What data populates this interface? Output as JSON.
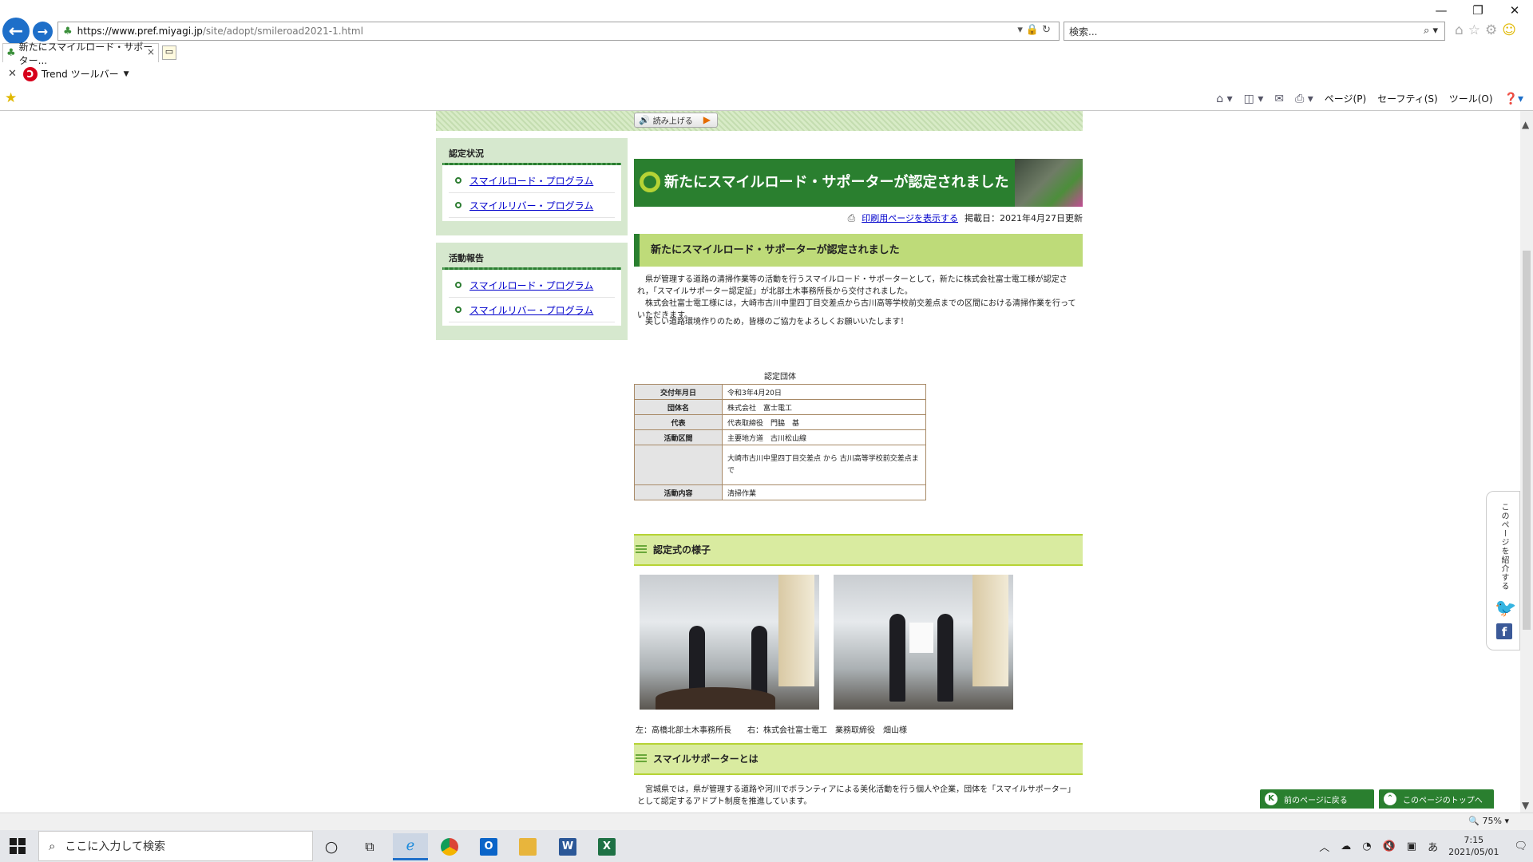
{
  "browser": {
    "url_scheme": "https://www.pref.miyagi.jp",
    "url_rest": "/site/adopt/smileroad2021-1.html",
    "search_placeholder": "検索...",
    "tab_title": "新たにスマイルロード・サポーター...",
    "trend_toolbar_label": "Trend ツールバー",
    "cmd_page": "ページ(P)",
    "cmd_safety": "セーフティ(S)",
    "cmd_tools": "ツール(O)",
    "zoom": "75%"
  },
  "sidebar": {
    "sections": [
      {
        "title": "認定状況",
        "items": [
          "スマイルロード・プログラム",
          "スマイルリバー・プログラム"
        ]
      },
      {
        "title": "活動報告",
        "items": [
          "スマイルロード・プログラム",
          "スマイルリバー・プログラム"
        ]
      }
    ]
  },
  "main": {
    "read_aloud_label": "読み上げる",
    "page_title": "新たにスマイルロード・サポーターが認定されました",
    "print_link": "印刷用ページを表示する",
    "posted_date": "掲載日：2021年4月27日更新",
    "section_heading": "新たにスマイルロード・サポーターが認定されました",
    "paragraph1": "　県が管理する道路の清掃作業等の活動を行うスマイルロード・サポーターとして，新たに株式会社富士電工様が認定され，「スマイルサポーター認定証」が北部土木事務所長から交付されました。",
    "paragraph1b": "　株式会社富士電工様には，大崎市古川中里四丁目交差点から古川高等学校前交差点までの区間における清掃作業を行っていただきます。",
    "paragraph2": "　美しい道路環境作りのため，皆様のご協力をよろしくお願いいたします！",
    "table": {
      "caption": "認定団体",
      "rows": [
        {
          "label": "交付年月日",
          "value": "令和3年4月20日"
        },
        {
          "label": "団体名",
          "value": "株式会社　富士電工"
        },
        {
          "label": "代表",
          "value": "代表取締役　門脇　基"
        },
        {
          "label": "活動区間",
          "value": "主要地方道　古川松山線"
        },
        {
          "label": "",
          "value": "大崎市古川中里四丁目交差点 から 古川高等学校前交差点まで"
        },
        {
          "label": "活動内容",
          "value": "清掃作業"
        }
      ]
    },
    "ceremony_heading": "認定式の様子",
    "photo_caption_left": "左：高橋北部土木事務所長",
    "photo_caption_right": "右：株式会社富士電工　業務取締役　畑山様",
    "about_heading": "スマイルサポーターとは",
    "paragraph3": "　宮城県では，県が管理する道路や河川でボランティアによる美化活動を行う個人や企業，団体を「スマイルサポーター」として認定するアドプト制度を推進しています。"
  },
  "share": {
    "label": "このページを紹介する"
  },
  "floating": {
    "prev_page": "前のページに戻る",
    "page_top": "このページのトップへ"
  },
  "taskbar": {
    "search_placeholder": "ここに入力して検索",
    "time": "7:15",
    "date": "2021/05/01",
    "ime": "あ"
  }
}
